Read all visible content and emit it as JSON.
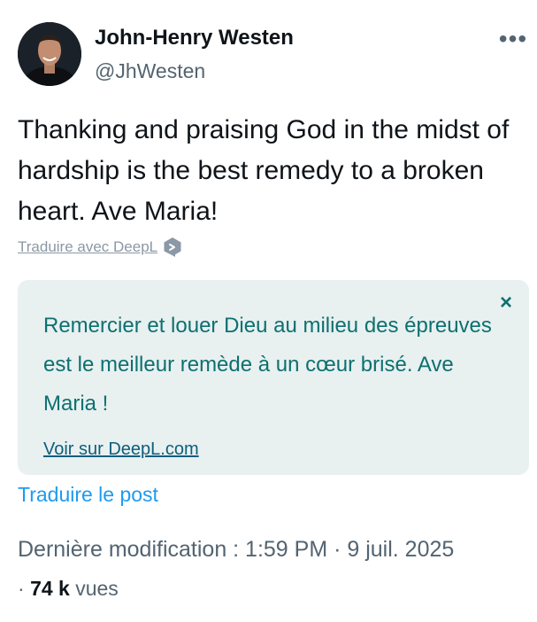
{
  "author": {
    "name": "John-Henry Westen",
    "handle": "@JhWesten"
  },
  "more_icon": "more-horizontal-icon",
  "post": {
    "text": "Thanking and praising God in the midst of hardship is the best remedy to a broken heart. Ave Maria!"
  },
  "translate_deepl": {
    "label": "Traduire avec DeepL"
  },
  "translation": {
    "text": "Remercier et louer Dieu au milieu des épreuves est le meilleur remède à un cœur brisé. Ave Maria !",
    "close_symbol": "×",
    "link": "Voir sur DeepL.com"
  },
  "translate_post": "Traduire le post",
  "meta": {
    "modified_label": "Dernière modification : 1:59 PM · 9 juil. 2025",
    "views_prefix": "·",
    "views_count": "74 k",
    "views_suffix": "vues"
  },
  "colors": {
    "translation_bg": "#e8f0f0",
    "translation_text": "#0e7070",
    "link_blue": "#1d9bf0",
    "secondary_text": "#536471"
  }
}
